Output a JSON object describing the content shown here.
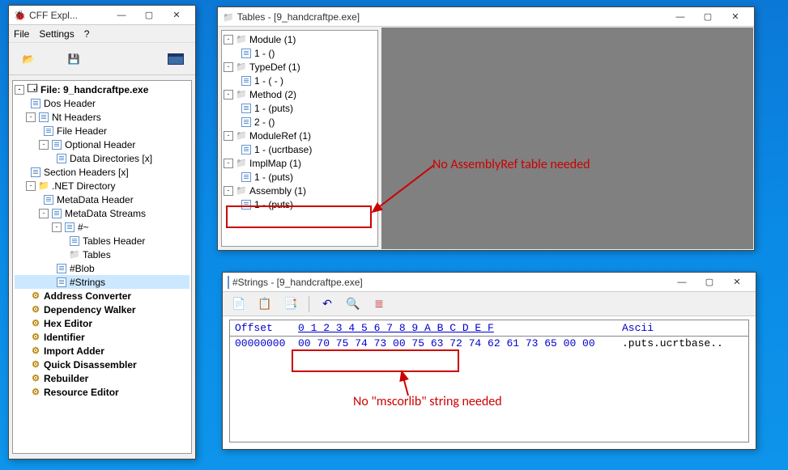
{
  "cff": {
    "title": "CFF Expl...",
    "menu": {
      "file": "File",
      "settings": "Settings",
      "help": "?"
    },
    "tree": {
      "file": "File: 9_handcraftpe.exe",
      "dos": "Dos Header",
      "nt": "Nt Headers",
      "fileh": "File Header",
      "opt": "Optional Header",
      "datadir": "Data Directories [x]",
      "sect": "Section Headers [x]",
      "netdir": ".NET Directory",
      "metah": "MetaData Header",
      "metas": "MetaData Streams",
      "htilde": "#~",
      "tablesh": "Tables Header",
      "tables": "Tables",
      "blob": "#Blob",
      "strings": "#Strings",
      "addr": "Address Converter",
      "dep": "Dependency Walker",
      "hex": "Hex Editor",
      "ident": "Identifier",
      "imp": "Import Adder",
      "quick": "Quick Disassembler",
      "reb": "Rebuilder",
      "res": "Resource Editor"
    }
  },
  "tables": {
    "title": "Tables - [9_handcraftpe.exe]",
    "items": {
      "module": "Module (1)",
      "module1": "1 - ()",
      "typedef": "TypeDef (1)",
      "typedef1": "1 - ( - )",
      "method": "Method (2)",
      "method1": "1 - (puts)",
      "method2": "2 - ()",
      "moduleref": "ModuleRef (1)",
      "moduleref1": "1 - (ucrtbase)",
      "implmap": "ImplMap (1)",
      "implmap1": "1 - (puts)",
      "assembly": "Assembly (1)",
      "assembly1": "1 - (puts)"
    }
  },
  "stringswin": {
    "title": "#Strings - [9_handcraftpe.exe]",
    "header": {
      "offset": "Offset",
      "cols": "0  1  2  3  4  5  6  7  8  9  A  B  C  D  E  F",
      "ascii": "Ascii"
    },
    "row": {
      "offset": "00000000",
      "bytes": "00 70 75 74 73 00 75 63 72 74 62 61 73 65 00 00",
      "ascii": ".puts.ucrtbase.."
    }
  },
  "annotations": {
    "noassembly": "No AssemblyRef table needed",
    "nomscorlib": "No \"mscorlib\" string needed"
  }
}
